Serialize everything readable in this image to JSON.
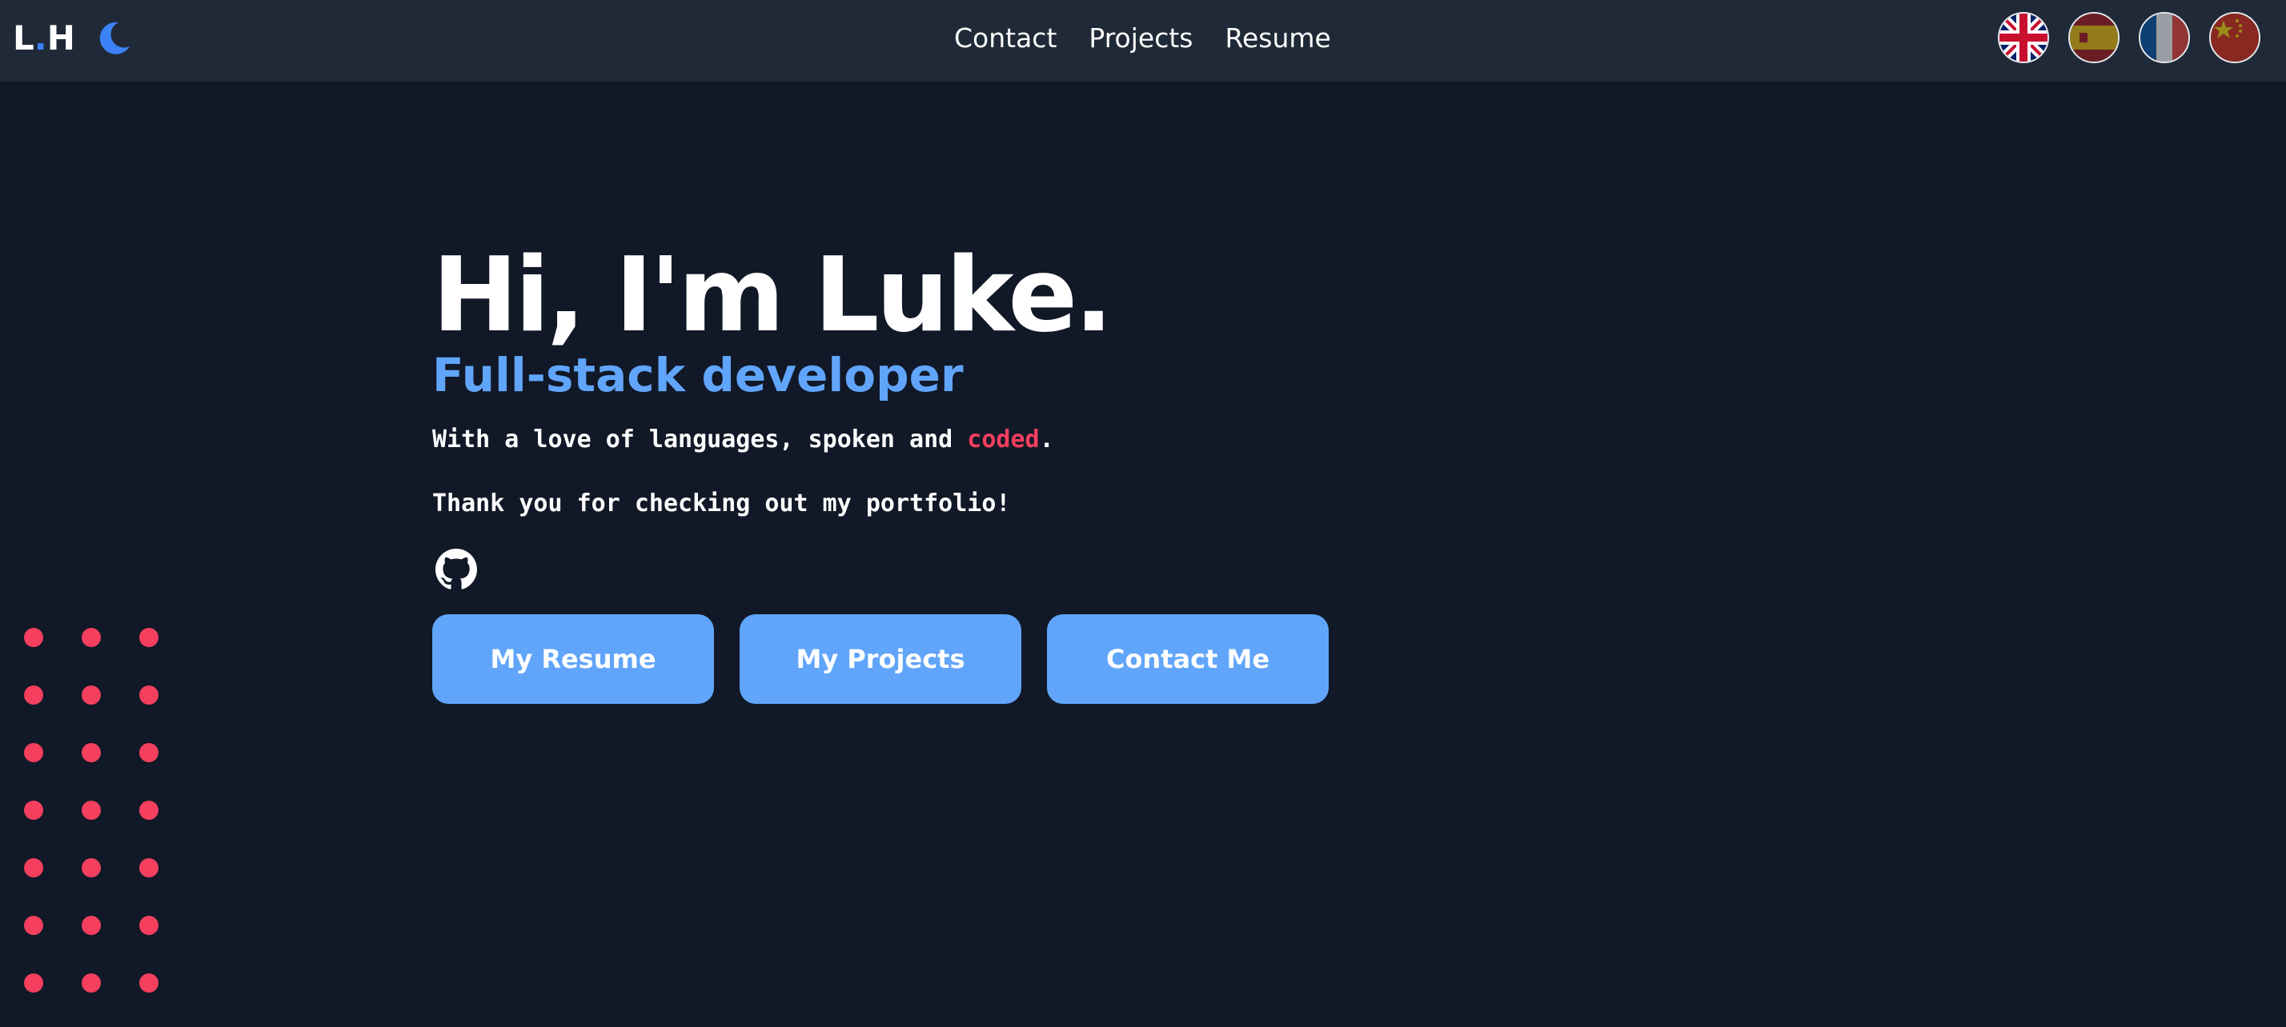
{
  "nav": {
    "logo_left": "L",
    "logo_dot": ".",
    "logo_right": "H",
    "theme_icon": "moon-icon",
    "links": [
      "Contact",
      "Projects",
      "Resume"
    ],
    "languages": [
      "uk-flag-icon",
      "spain-flag-icon",
      "france-flag-icon",
      "china-flag-icon"
    ]
  },
  "hero": {
    "title": "Hi, I'm Luke.",
    "subtitle": "Full-stack developer",
    "tagline_before": "With a love of languages, spoken and ",
    "tagline_accent": "coded",
    "tagline_after": ".",
    "thanks": "Thank you for checking out my portfolio!",
    "social_icon": "github-icon"
  },
  "buttons": {
    "resume": "My Resume",
    "projects": "My Projects",
    "contact": "Contact Me"
  },
  "colors": {
    "background": "#111827",
    "navbar": "#1f2937",
    "accent_blue": "#60a5fa",
    "accent_red": "#f43f5e"
  }
}
